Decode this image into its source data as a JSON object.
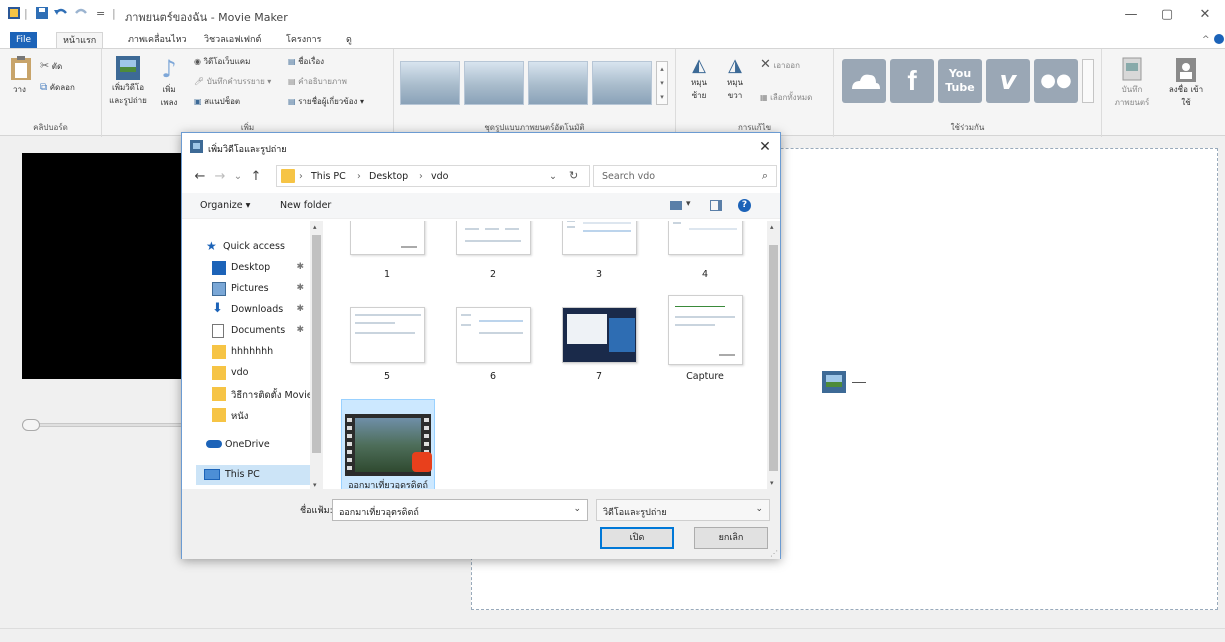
{
  "titlebar": {
    "title": "ภาพยนตร์ของฉัน - Movie Maker",
    "qa_separator": "|",
    "qa_dropdown": "=",
    "minimize": "—",
    "restore": "▢",
    "close": "✕",
    "ribbon_collapse": "^"
  },
  "tabs": [
    {
      "label": "File"
    },
    {
      "label": "หน้าแรก"
    },
    {
      "label": "ภาพเคลื่อนไหว"
    },
    {
      "label": "วิชวลเอฟเฟกต์"
    },
    {
      "label": "โครงการ"
    },
    {
      "label": "ดู"
    }
  ],
  "ribbon": {
    "clipboard": {
      "paste": "วาง",
      "cut": "ตัด",
      "copy": "คัดลอก",
      "group": "คลิปบอร์ด"
    },
    "add": {
      "add_videos_photos": "เพิ่มวิดีโอ และรูปถ่าย",
      "add_music": "เพิ่ม เพลง",
      "webcam_video": "วิดีโอเว็บแคม",
      "record_narration": "บันทึกคำบรรยาย",
      "snapshot": "สแนปช็อต",
      "title": "ชื่อเรื่อง",
      "caption": "คำอธิบายภาพ",
      "credits": "รายชื่อผู้เกี่ยวข้อง",
      "group": "เพิ่ม"
    },
    "themes": {
      "group": "ชุดรูปแบบภาพยนตร์อัตโนมัติ"
    },
    "editing": {
      "rotate_left": "หมุน ซ้าย",
      "rotate_right": "หมุน ขวา",
      "remove": "เอาออก",
      "select_all": "เลือกทั้งหมด",
      "group": "การแก้ไข"
    },
    "share": {
      "save_movie": "บันทึก ภาพยนตร์",
      "group": "ใช้ร่วมกัน",
      "sign_in": "ลงชื่อ เข้าใช้"
    }
  },
  "dialog": {
    "title": "เพิ่มวิดีโอและรูปถ่าย",
    "close": "✕",
    "nav": {
      "back": "←",
      "forward": "→",
      "recent": "⌄",
      "up": "↑"
    },
    "breadcrumb": [
      "This PC",
      "Desktop",
      "vdo"
    ],
    "crumb_sep": "›",
    "search_placeholder": "Search vdo",
    "organize": "Organize ▾",
    "new_folder": "New folder",
    "help": "?",
    "nav_items": [
      {
        "label": "Quick access",
        "icon": "star-icon"
      },
      {
        "label": "Desktop",
        "icon": "desktop-icon",
        "pinned": true
      },
      {
        "label": "Pictures",
        "icon": "pictures-icon",
        "pinned": true
      },
      {
        "label": "Downloads",
        "icon": "downloads-icon",
        "pinned": true
      },
      {
        "label": "Documents",
        "icon": "documents-icon",
        "pinned": true
      },
      {
        "label": "hhhhhhh",
        "icon": "folder-icon"
      },
      {
        "label": "vdo",
        "icon": "folder-icon"
      },
      {
        "label": "วิธีการติดตั้ง Movie",
        "icon": "folder-icon"
      },
      {
        "label": "หนัง",
        "icon": "folder-icon"
      },
      {
        "label": "OneDrive",
        "icon": "cloud-icon"
      },
      {
        "label": "This PC",
        "icon": "pc-icon",
        "selected": true
      }
    ],
    "pin_glyph": "✱",
    "files": [
      {
        "name": "1"
      },
      {
        "name": "2"
      },
      {
        "name": "3"
      },
      {
        "name": "4"
      },
      {
        "name": "5"
      },
      {
        "name": "6"
      },
      {
        "name": "7"
      },
      {
        "name": "Capture"
      },
      {
        "name": "ออกมาเที่ยวอุดรดิตถ์",
        "selected": true
      }
    ],
    "filename_label": "ชื่อแฟ้ม:",
    "filename_value": "ออกมาเที่ยวอุตรดิตถ์",
    "filetype_value": "วิดีโอและรูปถ่าย",
    "open": "เปิด",
    "cancel": "ยกเลิก"
  }
}
